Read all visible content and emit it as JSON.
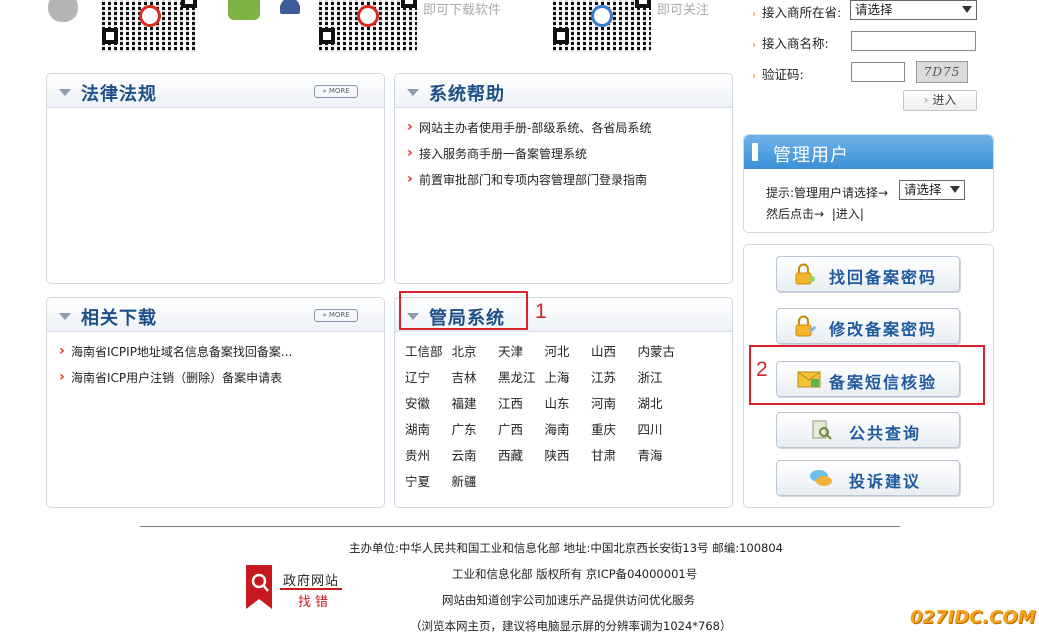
{
  "top": {
    "download_tip": "即可下载软件",
    "follow_tip": "即可关注"
  },
  "login": {
    "province_label": "接入商所在省:",
    "province_value": "请选择",
    "name_label": "接入商名称:",
    "captcha_label": "验证码:",
    "captcha_text": "7D75",
    "enter_button": "进入"
  },
  "laws": {
    "title": "法律法规",
    "more": "MORE"
  },
  "help": {
    "title": "系统帮助",
    "items": [
      "网站主办者使用手册-部级系统、各省局系统",
      "接入服务商手册一备案管理系统",
      "前置审批部门和专项内容管理部门登录指南"
    ]
  },
  "downloads": {
    "title": "相关下载",
    "more": "MORE",
    "items": [
      "海南省ICPIP地址域名信息备案找回备案...",
      "海南省ICP用户注销（删除）备案申请表"
    ]
  },
  "bureau": {
    "title": "管局系统",
    "provinces": [
      "工信部",
      "北京",
      "天津",
      "河北",
      "山西",
      "内蒙古",
      "辽宁",
      "吉林",
      "黑龙江",
      "上海",
      "江苏",
      "浙江",
      "安徽",
      "福建",
      "江西",
      "山东",
      "河南",
      "湖北",
      "湖南",
      "广东",
      "广西",
      "海南",
      "重庆",
      "四川",
      "贵州",
      "云南",
      "西藏",
      "陕西",
      "甘肃",
      "青海",
      "宁夏",
      "新疆"
    ]
  },
  "manager": {
    "title": "管理用户",
    "hint": "提示:管理用户请选择→",
    "select_value": "请选择",
    "then_click": "然后点击→",
    "enter_link": "|进入|"
  },
  "actions": {
    "recover": "找回备案密码",
    "modify": "修改备案密码",
    "sms_verify": "备案短信核验",
    "public_query": "公共查询",
    "complaint": "投诉建议"
  },
  "annotations": {
    "n1": "1",
    "n2": "2"
  },
  "footer": {
    "line1": "主办单位:中华人民共和国工业和信息化部 地址:中国北京西长安街13号 邮编:100804",
    "line2": "工业和信息化部 版权所有 京ICP备04000001号",
    "line3": "网站由知道创宇公司加速乐产品提供访问优化服务",
    "line4": "（浏览本网主页，建议将电脑显示屏的分辨率调为1024*768）",
    "gov_title": "政府网站",
    "gov_sub": "找错",
    "watermark": "027IDC.COM"
  },
  "colors": {
    "title_blue": "#1d4f88",
    "accent_red": "#d8232a",
    "header_blue": "#3b8fd6"
  }
}
